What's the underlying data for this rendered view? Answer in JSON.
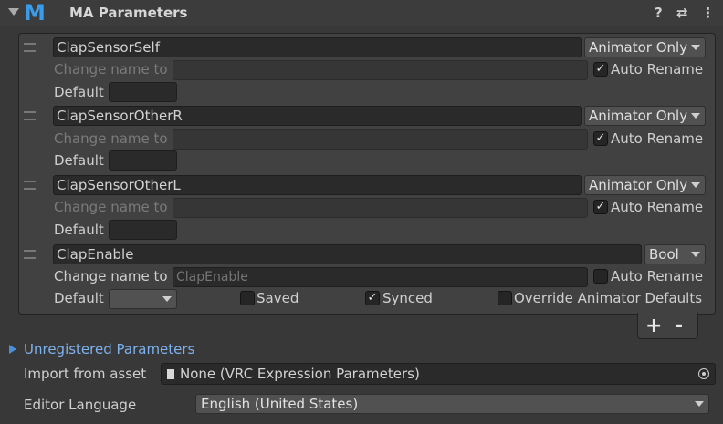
{
  "header": {
    "title": "MA Parameters",
    "logo": "M",
    "help_icon": "?",
    "settings_icon": "⇄",
    "more_icon": "⋮"
  },
  "params": [
    {
      "name": "ClapSensorSelf",
      "type": "Animator Only",
      "rename_label": "Change name to",
      "rename_value": "",
      "auto_rename_label": "Auto Rename",
      "auto_rename": true,
      "default_label": "Default"
    },
    {
      "name": "ClapSensorOtherR",
      "type": "Animator Only",
      "rename_label": "Change name to",
      "rename_value": "",
      "auto_rename_label": "Auto Rename",
      "auto_rename": true,
      "default_label": "Default"
    },
    {
      "name": "ClapSensorOtherL",
      "type": "Animator Only",
      "rename_label": "Change name to",
      "rename_value": "",
      "auto_rename_label": "Auto Rename",
      "auto_rename": true,
      "default_label": "Default"
    },
    {
      "name": "ClapEnable",
      "type": "Bool",
      "rename_label": "Change name to",
      "rename_placeholder": "ClapEnable",
      "auto_rename_label": "Auto Rename",
      "auto_rename": false,
      "default_label": "Default",
      "saved_label": "Saved",
      "saved": false,
      "synced_label": "Synced",
      "synced": true,
      "override_label": "Override Animator Defaults",
      "override": false
    }
  ],
  "list_controls": {
    "add": "+",
    "remove": "-"
  },
  "unregistered": {
    "label": "Unregistered Parameters"
  },
  "import": {
    "label": "Import from asset",
    "value": "None (VRC Expression Parameters)"
  },
  "language": {
    "label": "Editor Language",
    "value": "English (United States)"
  },
  "colors": {
    "accent": "#3a9be8",
    "link": "#7eb2ef",
    "background": "#383838"
  }
}
